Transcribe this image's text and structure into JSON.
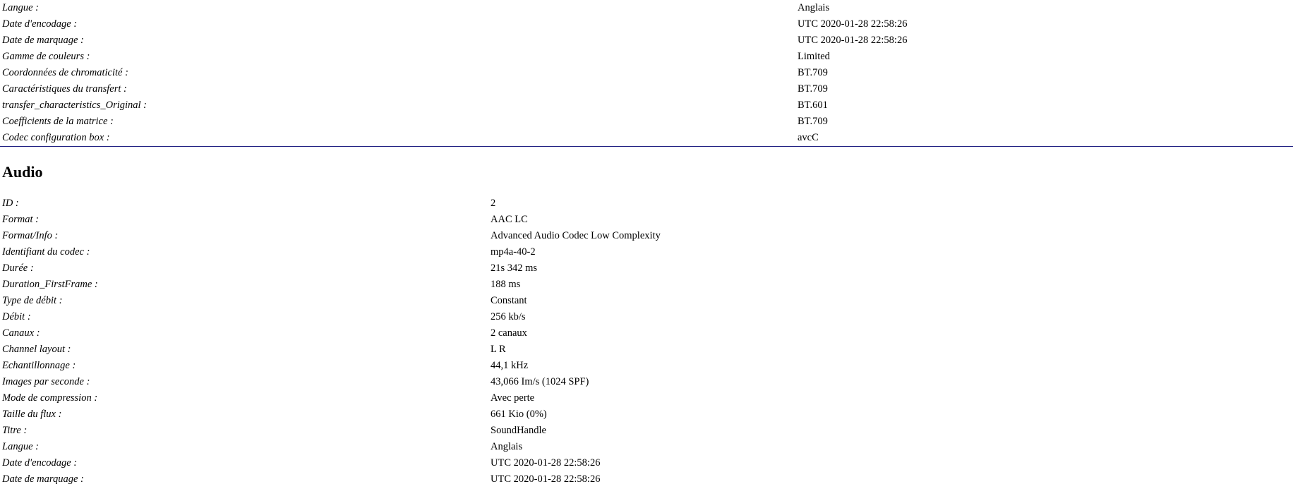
{
  "video_tail": {
    "rows": [
      {
        "label": "Langue :",
        "value": "Anglais"
      },
      {
        "label": "Date d'encodage :",
        "value": "UTC 2020-01-28 22:58:26"
      },
      {
        "label": "Date de marquage :",
        "value": "UTC 2020-01-28 22:58:26"
      },
      {
        "label": "Gamme de couleurs :",
        "value": "Limited"
      },
      {
        "label": "Coordonnées de chromaticité :",
        "value": "BT.709"
      },
      {
        "label": "Caractéristiques du transfert :",
        "value": "BT.709"
      },
      {
        "label": "transfer_characteristics_Original :",
        "value": "BT.601"
      },
      {
        "label": "Coefficients de la matrice :",
        "value": "BT.709"
      },
      {
        "label": "Codec configuration box :",
        "value": "avcC"
      }
    ]
  },
  "audio": {
    "title": "Audio",
    "rows": [
      {
        "label": "ID :",
        "value": "2"
      },
      {
        "label": "Format :",
        "value": "AAC LC"
      },
      {
        "label": "Format/Info :",
        "value": "Advanced Audio Codec Low Complexity"
      },
      {
        "label": "Identifiant du codec :",
        "value": "mp4a-40-2"
      },
      {
        "label": "Durée :",
        "value": "21s 342 ms"
      },
      {
        "label": "Duration_FirstFrame :",
        "value": "188 ms"
      },
      {
        "label": "Type de débit :",
        "value": "Constant"
      },
      {
        "label": "Débit :",
        "value": "256 kb/s"
      },
      {
        "label": "Canaux :",
        "value": "2 canaux"
      },
      {
        "label": "Channel layout :",
        "value": "L R"
      },
      {
        "label": "Echantillonnage :",
        "value": "44,1 kHz"
      },
      {
        "label": "Images par seconde :",
        "value": "43,066 Im/s (1024 SPF)"
      },
      {
        "label": "Mode de compression :",
        "value": "Avec perte"
      },
      {
        "label": "Taille du flux :",
        "value": "661 Kio (0%)"
      },
      {
        "label": "Titre :",
        "value": "SoundHandle"
      },
      {
        "label": "Langue :",
        "value": "Anglais"
      },
      {
        "label": "Date d'encodage :",
        "value": "UTC 2020-01-28 22:58:26"
      },
      {
        "label": "Date de marquage :",
        "value": "UTC 2020-01-28 22:58:26"
      }
    ]
  }
}
